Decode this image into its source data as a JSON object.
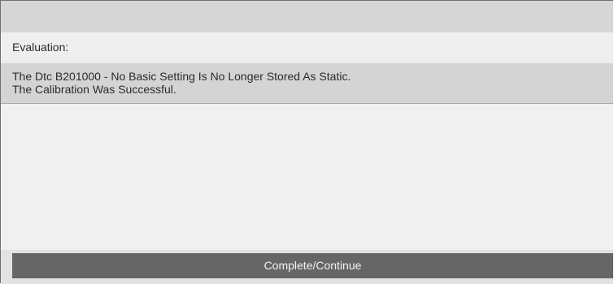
{
  "evaluation": {
    "label": "Evaluation:"
  },
  "result": {
    "lines": [
      "The Dtc B201000 - No Basic Setting Is No Longer Stored As Static.",
      "The Calibration Was Successful."
    ]
  },
  "actions": {
    "continue_label": "Complete/Continue"
  },
  "colors": {
    "top_bar": "#d6d6d6",
    "result_background": "#d4d4d4",
    "content_background": "#f0f0f0",
    "button_background": "#666666",
    "button_text": "#f2f2f2"
  }
}
